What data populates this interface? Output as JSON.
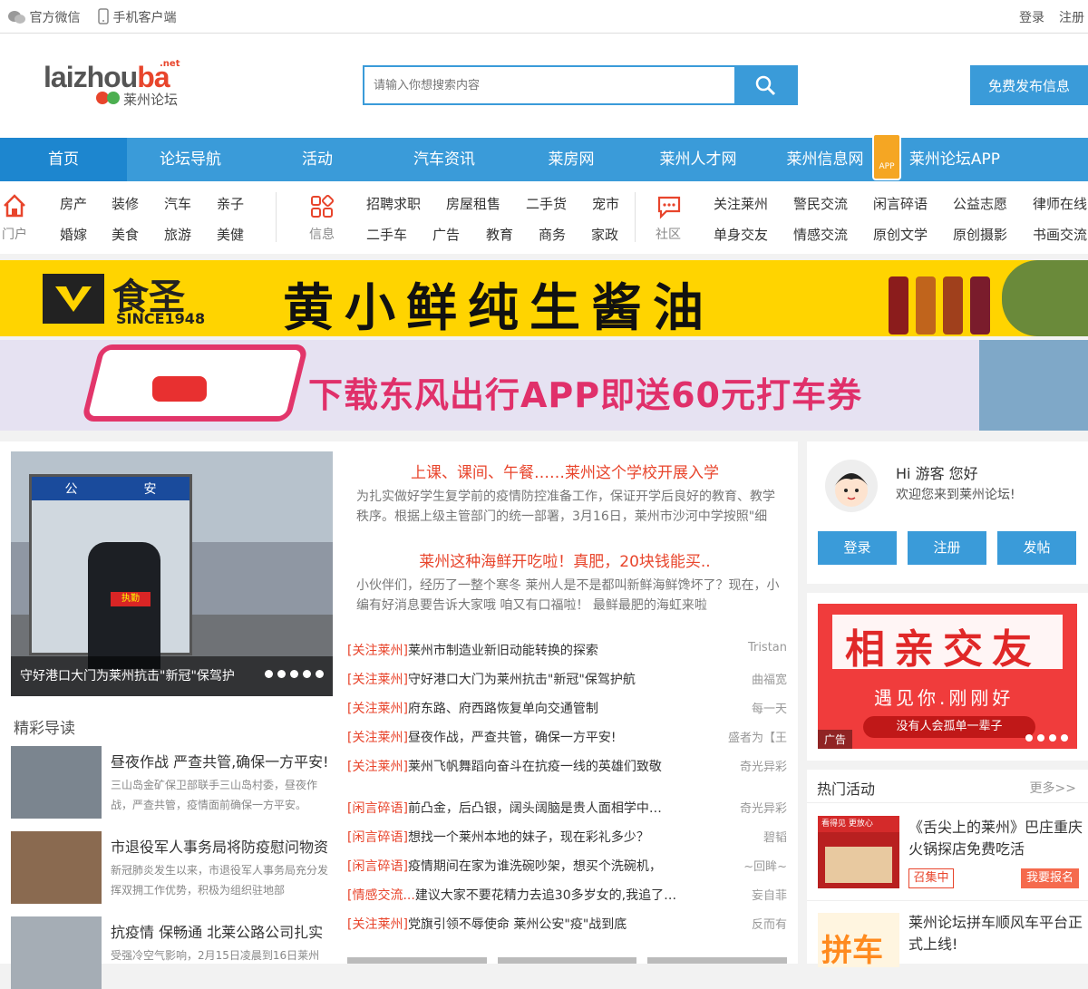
{
  "topbar": {
    "wechat": "官方微信",
    "mobile": "手机客户端",
    "login": "登录",
    "register": "注册"
  },
  "logo": {
    "main_a": "laizhou",
    "main_b": "ba",
    "net": ".net",
    "cn": "莱州论坛"
  },
  "search": {
    "placeholder": "请输入你想搜索内容"
  },
  "post_button": "免费发布信息",
  "nav": [
    "首页",
    "论坛导航",
    "活动",
    "汽车资讯",
    "莱房网",
    "莱州人才网",
    "莱州信息网",
    "莱州论坛APP"
  ],
  "nav_app_badge": "APP",
  "subnav": {
    "g1": {
      "label": "门户",
      "row1": [
        "房产",
        "装修",
        "汽车",
        "亲子"
      ],
      "row2": [
        "婚嫁",
        "美食",
        "旅游",
        "美健"
      ]
    },
    "g2": {
      "label": "信息",
      "row1": [
        "招聘求职",
        "房屋租售",
        "二手货",
        "宠市"
      ],
      "row2": [
        "二手车",
        "广告",
        "教育",
        "商务",
        "家政"
      ]
    },
    "g3": {
      "label": "社区",
      "row1": [
        "关注莱州",
        "警民交流",
        "闲言碎语",
        "公益志愿",
        "律师在线"
      ],
      "row2": [
        "单身交友",
        "情感交流",
        "原创文学",
        "原创摄影",
        "书画交流"
      ]
    }
  },
  "ads": {
    "ad1_brand": "食圣",
    "ad1_since": "SINCE1948",
    "ad1_slogan": "黄小鲜纯生酱油",
    "ad2_slogan": "下载东风出行APP即送60元打车券"
  },
  "slide": {
    "caption": "守好港口大门为莱州抗击\"新冠\"保驾护",
    "sign1": "公",
    "sign2": "安",
    "armband": "执勤"
  },
  "headlines": [
    {
      "title": "上课、课间、午餐……莱州这个学校开展入学",
      "desc": "为扎实做好学生复学前的疫情防控准备工作，保证开学后良好的教育、教学秩序。根据上级主管部门的统一部署，3月16日，莱州市沙河中学按照\"细"
    },
    {
      "title": "莱州这种海鲜开吃啦！真肥，20块钱能买..",
      "desc": "小伙伴们，经历了一整个寒冬 莱州人是不是都叫新鲜海鲜馋坏了？现在，小编有好消息要告诉大家哦 咱又有口福啦！ 最鲜最肥的海虹来啦"
    }
  ],
  "list": [
    {
      "tag": "[关注莱州]",
      "title": "莱州市制造业新旧动能转换的探索",
      "author": "Tristan"
    },
    {
      "tag": "[关注莱州]",
      "title": "守好港口大门为莱州抗击\"新冠\"保驾护航",
      "author": "曲福宽"
    },
    {
      "tag": "[关注莱州]",
      "title": "府东路、府西路恢复单向交通管制",
      "author": "每一天"
    },
    {
      "tag": "[关注莱州]",
      "title": "昼夜作战，严查共管，确保一方平安!",
      "author": "盛者为【王"
    },
    {
      "tag": "[关注莱州]",
      "title": "莱州飞帆舞蹈向奋斗在抗疫一线的英雄们致敬",
      "author": "奇光异彩"
    },
    {
      "tag": "[闲言碎语]",
      "title": "前凸金，后凸银，阔头阔脑是贵人面相学中…",
      "author": "奇光异彩"
    },
    {
      "tag": "[闲言碎语]",
      "title": "想找一个莱州本地的妹子，现在彩礼多少？",
      "author": "碧韬"
    },
    {
      "tag": "[闲言碎语]",
      "title": "疫情期间在家为谁洗碗吵架，想买个洗碗机，",
      "author": "~回眸~"
    },
    {
      "tag": "[情感交流...",
      "title": "建议大家不要花精力去追30多岁女的,我追了…",
      "author": "妄自菲"
    },
    {
      "tag": "[关注莱州]",
      "title": "党旗引领不辱使命 莱州公安\"疫\"战到底",
      "author": "反而有"
    }
  ],
  "guide": {
    "heading": "精彩导读",
    "items": [
      {
        "title": "昼夜作战 严查共管,确保一方平安!",
        "desc": "三山岛金矿保卫部联手三山岛村委，昼夜作战，严查共管，疫情面前确保一方平安。"
      },
      {
        "title": "市退役军人事务局将防疫慰问物资",
        "desc": "新冠肺炎发生以来，市退役军人事务局充分发挥双拥工作优势，积极为组织驻地部"
      },
      {
        "title": "抗疫情 保畅通 北莱公路公司扎实",
        "desc": "受强冷空气影响，2月15日凌晨到16日莱州"
      }
    ]
  },
  "user_panel": {
    "hi": "Hi 游客 您好",
    "welcome": "欢迎您来到莱州论坛!",
    "buttons": [
      "登录",
      "注册",
      "发帖"
    ]
  },
  "side_ad": {
    "title": "相亲交友",
    "sub": "遇见你.刚刚好",
    "banner": "没有人会孤单一辈子",
    "label": "广告"
  },
  "hot": {
    "heading": "热门活动",
    "more": "更多>>",
    "items": [
      {
        "title": "《舌尖上的莱州》巴庄重庆火锅探店免费吃活",
        "status": "召集中",
        "action": "我要报名",
        "thumb": "看得见 更放心"
      },
      {
        "title": "莱州论坛拼车顺风车平台正式上线!",
        "thumb": "拼车"
      }
    ]
  },
  "colors": {
    "accent": "#3a9bd9",
    "nav_active": "#1d86cf",
    "red": "#e8452c"
  }
}
